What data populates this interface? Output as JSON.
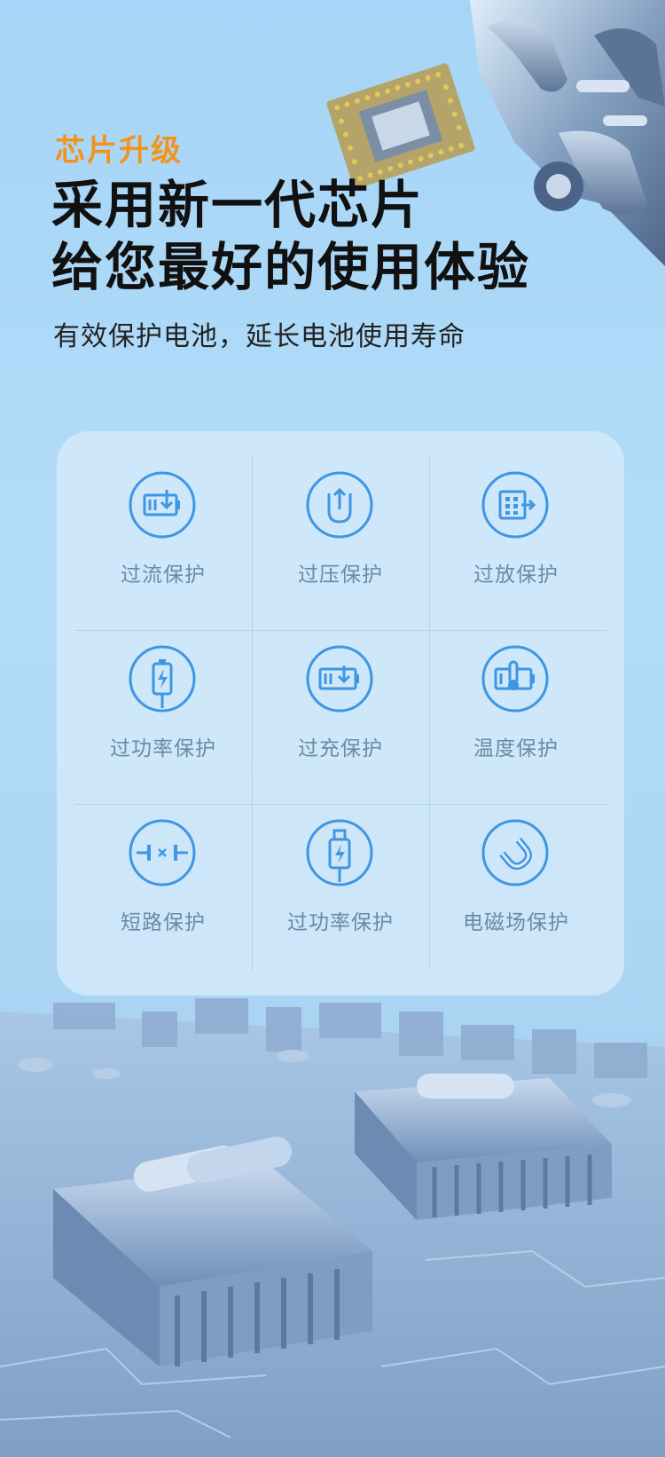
{
  "eyebrow": "芯片升级",
  "headline": [
    "采用新一代芯片",
    "给您最好的使用体验"
  ],
  "subline": "有效保护电池，延长电池使用寿命",
  "accent_color": "#f2931b",
  "icon_color": "#3f96e3",
  "features": [
    {
      "label": "过流保护",
      "icon": "battery-download-icon"
    },
    {
      "label": "过压保护",
      "icon": "shield-arrow-icon"
    },
    {
      "label": "过放保护",
      "icon": "chip-export-icon"
    },
    {
      "label": "过功率保护",
      "icon": "battery-lightning-icon"
    },
    {
      "label": "过充保护",
      "icon": "battery-charge-icon"
    },
    {
      "label": "温度保护",
      "icon": "thermometer-battery-icon"
    },
    {
      "label": "短路保护",
      "icon": "short-circuit-icon"
    },
    {
      "label": "过功率保护",
      "icon": "usb-plug-lightning-icon"
    },
    {
      "label": "电磁场保护",
      "icon": "magnet-icon"
    }
  ]
}
